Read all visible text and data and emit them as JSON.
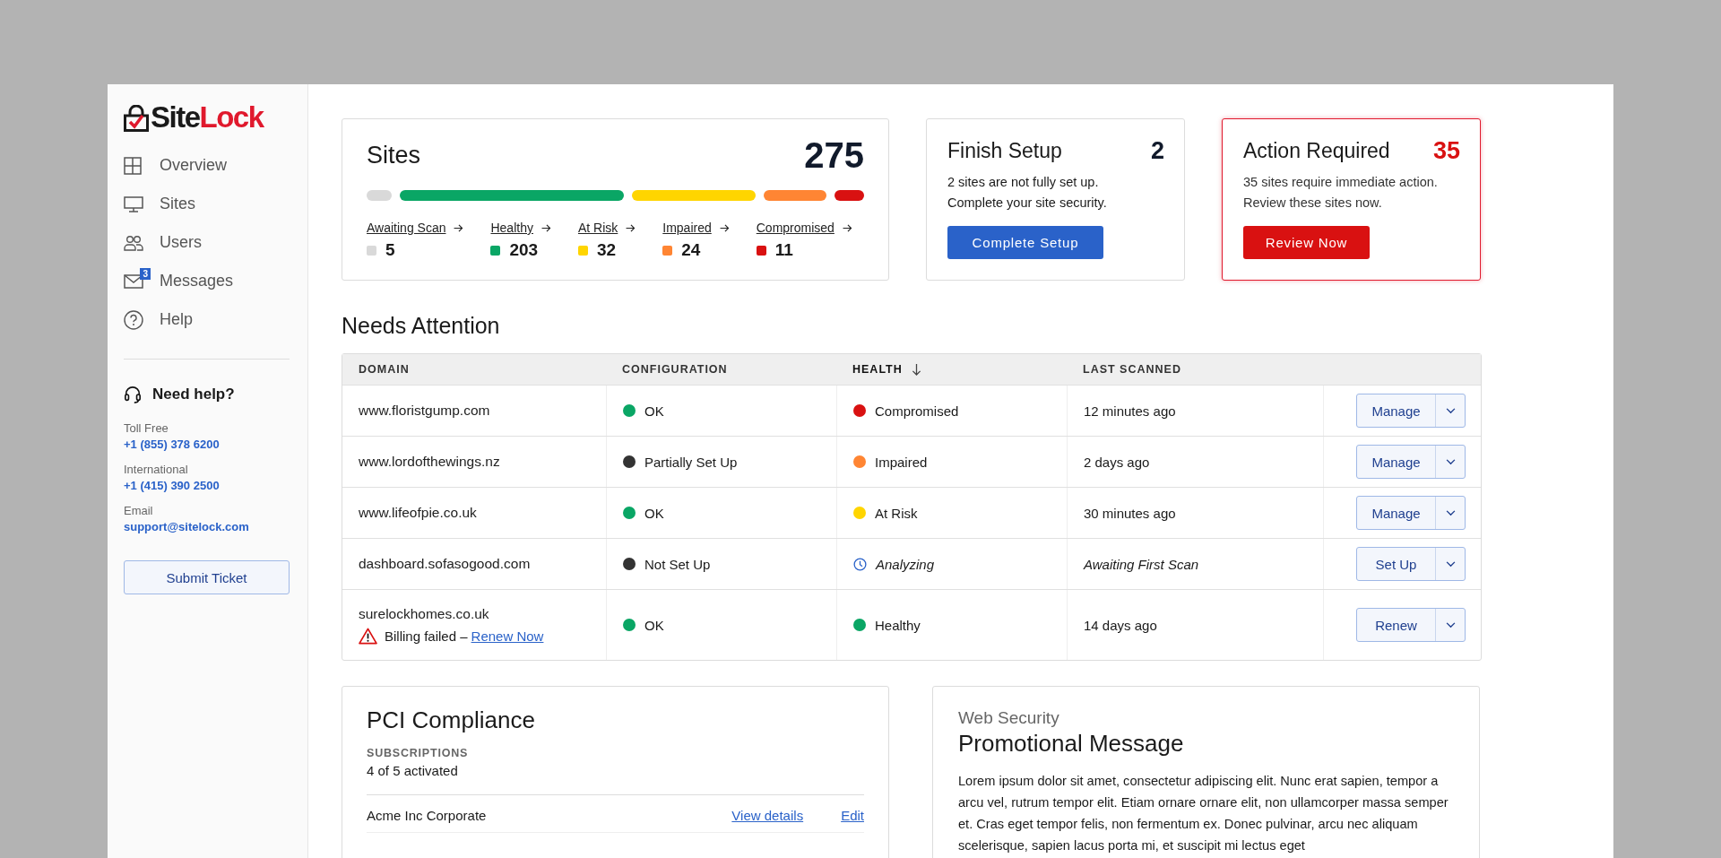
{
  "sidebar": {
    "logo": {
      "dark": "Site",
      "accent": "Lock"
    },
    "nav": [
      {
        "label": "Overview"
      },
      {
        "label": "Sites"
      },
      {
        "label": "Users"
      },
      {
        "label": "Messages",
        "badge": "3"
      },
      {
        "label": "Help"
      }
    ],
    "help": {
      "title": "Need help?",
      "contacts": [
        {
          "label": "Toll Free",
          "value": "+1 (855) 378 6200"
        },
        {
          "label": "International",
          "value": "+1 (415) 390 2500"
        },
        {
          "label": "Email",
          "value": "support@sitelock.com"
        }
      ],
      "button": "Submit Ticket"
    }
  },
  "sites_card": {
    "title": "Sites",
    "total": "275",
    "statuses": [
      {
        "label": "Awaiting Scan",
        "count": "5",
        "color": "#d9d9d9"
      },
      {
        "label": "Healthy",
        "count": "203",
        "color": "#0aa665"
      },
      {
        "label": "At Risk",
        "count": "32",
        "color": "#ffd500"
      },
      {
        "label": "Impaired",
        "count": "24",
        "color": "#ff8533"
      },
      {
        "label": "Compromised",
        "count": "11",
        "color": "#d91111"
      }
    ]
  },
  "summary_cards": [
    {
      "kind": "setup",
      "title": "Finish Setup",
      "count": "2",
      "lines": [
        "2 sites are not fully set up.",
        "Complete your site security."
      ],
      "button": "Complete Setup"
    },
    {
      "kind": "alert",
      "title": "Action Required",
      "count": "35",
      "lines": [
        "35 sites require immediate action.",
        "Review these sites now."
      ],
      "button": "Review Now"
    }
  ],
  "needs_attention": {
    "title": "Needs Attention",
    "columns": [
      {
        "label": "DOMAIN",
        "sorted": false
      },
      {
        "label": "CONFIGURATION",
        "sorted": false
      },
      {
        "label": "HEALTH",
        "sorted": true
      },
      {
        "label": "LAST SCANNED",
        "sorted": false
      }
    ],
    "rows": [
      {
        "domain": "www.floristgump.com",
        "configuration": {
          "label": "OK",
          "color": "#0aa665"
        },
        "health": {
          "kind": "dot",
          "label": "Compromised",
          "color": "#d91111"
        },
        "last_scanned": {
          "kind": "time",
          "text": "12 minutes ago"
        },
        "action": "Manage"
      },
      {
        "domain": "www.lordofthewings.nz",
        "configuration": {
          "label": "Partially Set Up",
          "color": "#333333"
        },
        "health": {
          "kind": "dot",
          "label": "Impaired",
          "color": "#ff8533"
        },
        "last_scanned": {
          "kind": "time",
          "text": "2 days ago"
        },
        "action": "Manage"
      },
      {
        "domain": "www.lifeofpie.co.uk",
        "configuration": {
          "label": "OK",
          "color": "#0aa665"
        },
        "health": {
          "kind": "dot",
          "label": "At Risk",
          "color": "#ffd500"
        },
        "last_scanned": {
          "kind": "time",
          "text": "30 minutes ago"
        },
        "action": "Manage"
      },
      {
        "domain": "dashboard.sofasogood.com",
        "configuration": {
          "label": "Not Set Up",
          "color": "#333333"
        },
        "health": {
          "kind": "pending",
          "label": "Analyzing"
        },
        "last_scanned": {
          "kind": "pending",
          "text": "Awaiting First Scan"
        },
        "action": "Set Up"
      },
      {
        "domain": "surelockhomes.co.uk",
        "warning": {
          "text": "Billing failed –",
          "link": "Renew Now"
        },
        "configuration": {
          "label": "OK",
          "color": "#0aa665"
        },
        "health": {
          "kind": "dot",
          "label": "Healthy",
          "color": "#0aa665"
        },
        "last_scanned": {
          "kind": "time",
          "text": "14 days ago"
        },
        "action": "Renew"
      }
    ]
  },
  "pci": {
    "title": "PCI Compliance",
    "subscriptions_label": "SUBSCRIPTIONS",
    "subscriptions_value": "4 of 5 activated",
    "items": [
      {
        "name": "Acme Inc Corporate",
        "links": [
          "View details",
          "Edit"
        ]
      }
    ]
  },
  "promo": {
    "eyebrow": "Web Security",
    "title": "Promotional Message",
    "text": "Lorem ipsum dolor sit amet, consectetur adipiscing elit. Nunc erat sapien, tempor a arcu vel, rutrum tempor elit. Etiam ornare ornare elit, non ullamcorper massa semper et. Cras eget tempor felis, non fermentum ex. Donec pulvinar, arcu nec aliquam scelerisque, sapien lacus porta mi, et suscipit mi lectus eget"
  }
}
